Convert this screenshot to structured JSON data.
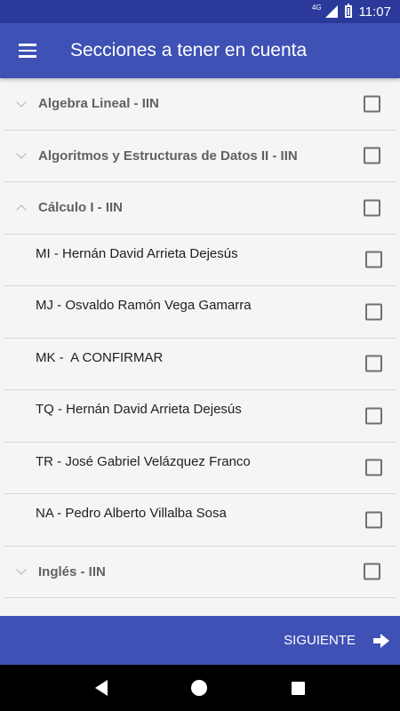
{
  "status_bar": {
    "network": "4G",
    "time": "11:07"
  },
  "app_bar": {
    "title": "Secciones a tener en cuenta"
  },
  "courses": [
    {
      "label": "Algebra Lineal - IIN",
      "expanded": false
    },
    {
      "label": "Algoritmos y Estructuras de Datos II - IIN",
      "expanded": false
    },
    {
      "label": "Cálculo I - IIN",
      "expanded": true,
      "sections": [
        "MI - Hernán David Arrieta Dejesús",
        "MJ - Osvaldo Ramón Vega Gamarra",
        "MK -  A CONFIRMAR",
        "TQ - Hernán David Arrieta Dejesús",
        "TR - José Gabriel Velázquez Franco",
        "NA - Pedro Alberto Villalba Sosa"
      ]
    },
    {
      "label": "Inglés - IIN",
      "expanded": false
    }
  ],
  "footer": {
    "next_label": "SIGUIENTE"
  },
  "colors": {
    "primary": "#3f51b5",
    "status_bar": "#2b3a9a"
  }
}
